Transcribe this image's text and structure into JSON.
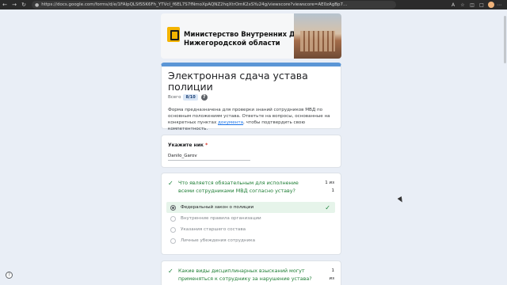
{
  "browser": {
    "url": "https://docs.google.com/forms/d/e/1FAIpQLSfS5K6Fh_YTVcI_f6EL7S7fNmoXpAQNZ2hqXtrOmK2xSYu24g/viewscore?viewscore=AE0zAgBp7...",
    "back_icon": "arrow-left",
    "forward_icon": "arrow-right",
    "reload_icon": "reload"
  },
  "banner": {
    "name": "Министерство Внутренних Дел Нижегородской области"
  },
  "header": {
    "title": "Электронная сдача устава полиции",
    "score_label": "Всего",
    "score_value": "8/10",
    "help": "?",
    "description_part1": "Форма предназначена для проверки знаний сотрудников МВД по основным положениям устава. Ответьте на вопросы, основанные на конкретных пунктах ",
    "description_link": "документа",
    "description_part2": ", чтобы подтвердить свою компетентность."
  },
  "nick": {
    "label": "Укажите ник",
    "required_mark": "*",
    "value": "Danilo_Garov"
  },
  "questions": [
    {
      "text": "Что является обязательным для исполнение всеми сотрудниками МВД согласно уставу?",
      "points_line1": "1 из",
      "points_line2": "1",
      "options": [
        {
          "label": "Федеральный закон о полиции",
          "selected": true,
          "correct": true
        },
        {
          "label": "Внутренние правила организации",
          "selected": false
        },
        {
          "label": "Указания старшего состава",
          "selected": false
        },
        {
          "label": "Личные убеждения сотрудника",
          "selected": false
        }
      ]
    },
    {
      "text": "Какие виды дисциплинарных взысканий могут применяться к сотруднику за нарушение устава?",
      "points_line1": "1",
      "points_line2": "из"
    }
  ],
  "colors": {
    "accent": "#5b96d6",
    "correct": "#188038",
    "background": "#e9eef6"
  }
}
